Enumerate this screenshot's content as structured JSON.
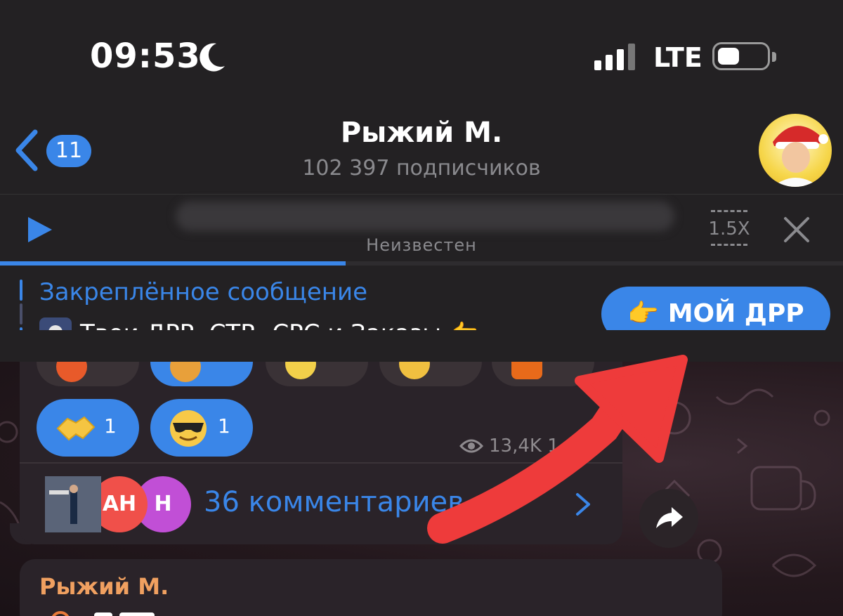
{
  "status_bar": {
    "time": "09:53",
    "network": "LTE"
  },
  "header": {
    "back_count": "11",
    "title": "Рыжий М.",
    "subtitle": "102 397 подписчиков"
  },
  "player": {
    "performer": "Неизвестен",
    "speed": "1.5X",
    "progress": 0.41
  },
  "pinned": {
    "label": "Закреплённое сообщение",
    "text": "Твои ДРР, CTR, CPC и Заказы 👉...",
    "button": "👉 МОЙ ДРР"
  },
  "message": {
    "reactions": [
      {
        "emoji": "handshake",
        "count": "1"
      },
      {
        "emoji": "cool-face",
        "count": "1"
      }
    ],
    "views": "13,4K",
    "time_partial": "1",
    "comments": "36 комментариев",
    "comment_avatars": [
      "",
      "АН",
      "Н"
    ]
  },
  "message2": {
    "sender": "Рыжий М."
  },
  "colors": {
    "accent": "#3a86e8",
    "annotation_arrow": "#ee3b3b",
    "sender_name": "#f0a060"
  }
}
